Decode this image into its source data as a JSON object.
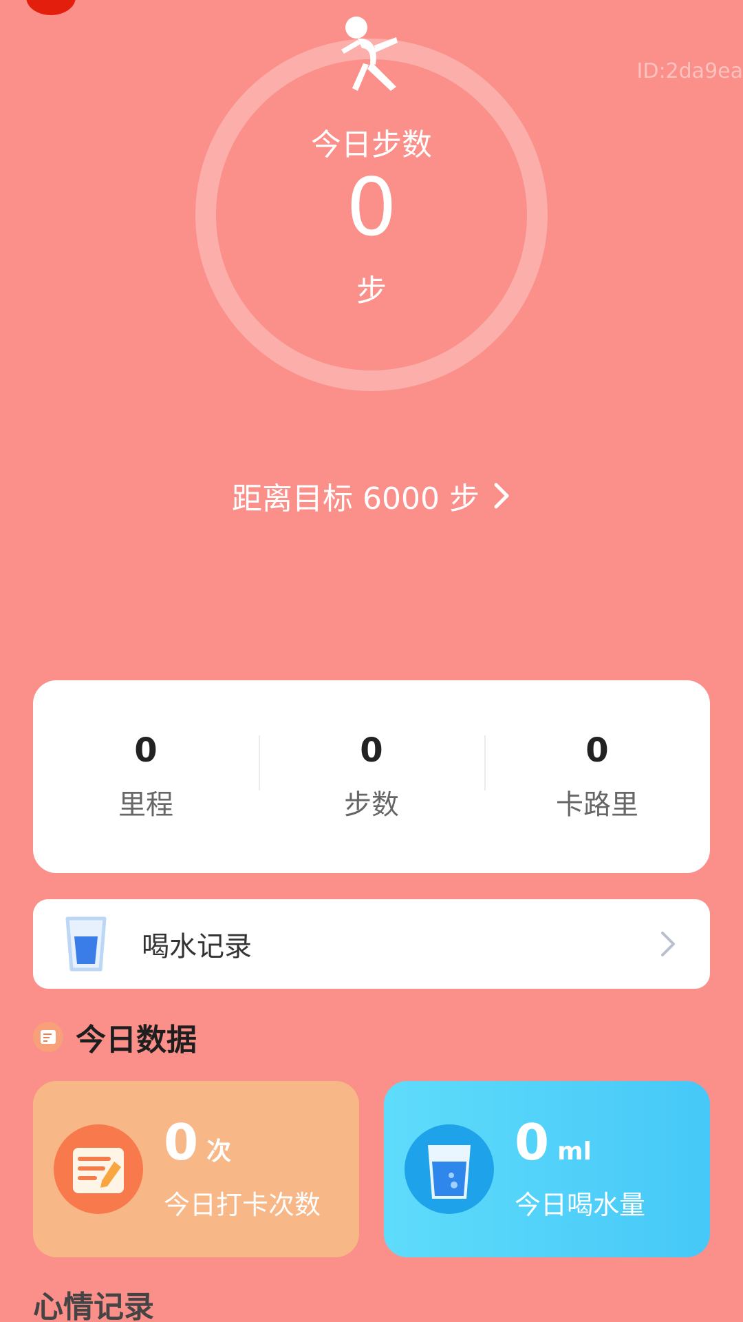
{
  "watermark": "ID:2da9ea",
  "steps_ring": {
    "title": "今日步数",
    "count": "0",
    "unit": "步"
  },
  "goal": {
    "text": "距离目标 6000 步"
  },
  "stats": [
    {
      "value": "0",
      "label": "里程"
    },
    {
      "value": "0",
      "label": "步数"
    },
    {
      "value": "0",
      "label": "卡路里"
    }
  ],
  "water_record": {
    "label": "喝水记录"
  },
  "today_section": {
    "title": "今日数据"
  },
  "cards": {
    "punch": {
      "value": "0",
      "unit": "次",
      "label": "今日打卡次数"
    },
    "water": {
      "value": "0",
      "unit": "ml",
      "label": "今日喝水量"
    }
  },
  "mood_section": {
    "title": "心情记录"
  },
  "colors": {
    "background": "#fb8f89",
    "punch_card": "#f7b787",
    "water_card": "#46c8f8",
    "accent_red": "#e41e0c"
  },
  "icons": {
    "runner": "runner-icon",
    "goal_chevron": "chevron-right-icon",
    "cup": "water-cup-icon",
    "row_chevron": "chevron-right-icon",
    "section": "notepad-icon",
    "punch": "notepad-pen-icon",
    "water": "water-glass-icon"
  }
}
